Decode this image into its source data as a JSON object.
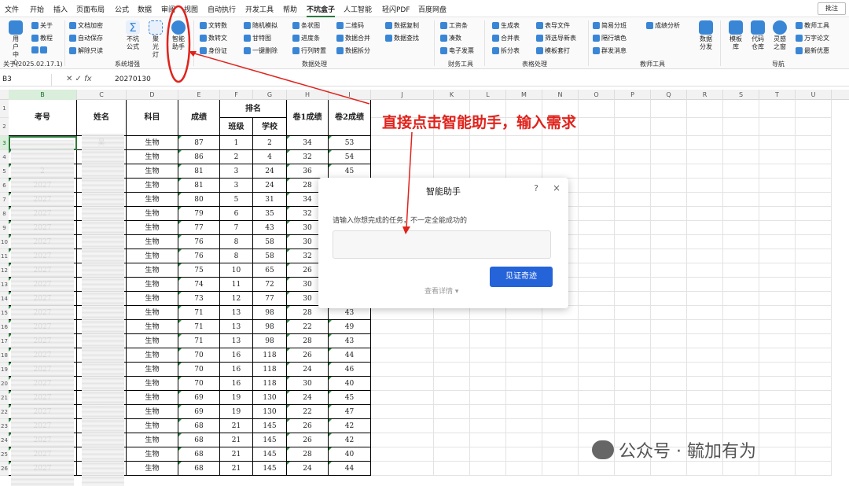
{
  "menu": [
    "文件",
    "开始",
    "插入",
    "页面布局",
    "公式",
    "数据",
    "审阅",
    "视图",
    "自动执行",
    "开发工具",
    "帮助",
    "不坑盒子",
    "人工智能",
    "轻闪PDF",
    "百度网盘"
  ],
  "comment_label": "批注",
  "ribbon": {
    "user_center": "用户中心",
    "about": "关于",
    "tutorial": "教程",
    "doc_encrypt": "文档加密",
    "auto_save": "自动保存",
    "unlock_readonly": "解除只读",
    "no_pit_formula": "不坑公式",
    "spotlight": "聚光灯",
    "smart_assistant": "智能助手",
    "text_to_num": "文转数",
    "num_to_text": "数转文",
    "id_card": "身份证",
    "random_sim": "随机模拟",
    "gantt": "甘特图",
    "one_click_delete": "一键删除",
    "bar_chart": "条状图",
    "progress_bar": "进度条",
    "row_col_convert": "行列转置",
    "qr_code": "二维码",
    "data_merge": "数据合并",
    "data_split": "数据拆分",
    "data_copy": "数据复制",
    "data_lookup": "数据查找",
    "pay_slip": "工资条",
    "round_up": "凑数",
    "e_invoice": "电子发票",
    "gen_table": "生成表",
    "merge_table": "合并表",
    "split_table": "拆分表",
    "header_import": "表导文件",
    "filter_new_table": "筛选导新表",
    "template_fill": "模板套打",
    "easy_class": "简易分班",
    "alt_row_color": "隔行填色",
    "group_msg": "群发消息",
    "score_analysis": "成绩分析",
    "data_split_big": "数据分发",
    "template_lib": "模板库",
    "code_repo": "代码仓库",
    "inspiration": "灵感之窗",
    "teacher_tools": "教师工具",
    "thesis": "万字论文",
    "latest_offers": "最新优惠"
  },
  "group_labels": {
    "about_version": "关于(2025.02.17.1)",
    "system_enhance": "系统增强",
    "data_processing": "数据处理",
    "finance_tools": "财务工具",
    "table_processing": "表格处理",
    "teacher_tools": "教师工具",
    "navigation": "导航"
  },
  "formula_bar": {
    "cell_ref": "B3",
    "fx": "fx",
    "value": "20270130"
  },
  "columns": [
    "B",
    "C",
    "D",
    "E",
    "F",
    "G",
    "H",
    "I",
    "J",
    "K",
    "L",
    "M",
    "N",
    "O",
    "P",
    "Q",
    "R",
    "S",
    "T",
    "U"
  ],
  "rows": [
    "1",
    "2",
    "3",
    "4",
    "5",
    "6",
    "7",
    "8",
    "9",
    "10",
    "11",
    "12",
    "13",
    "14",
    "15",
    "16",
    "17",
    "18",
    "19",
    "20",
    "21",
    "22",
    "23",
    "24",
    "25",
    "26",
    "27"
  ],
  "table": {
    "headers": {
      "id": "考号",
      "name": "姓名",
      "subject": "科目",
      "score": "成绩",
      "rank": "排名",
      "rank_class": "班级",
      "rank_school": "学校",
      "paper1": "卷1成绩",
      "paper2": "卷2成绩"
    },
    "rows": [
      {
        "id": "",
        "name": "吴",
        "subject": "生物",
        "score": "87",
        "cls": "1",
        "sch": "2",
        "p1": "34",
        "p2": "53"
      },
      {
        "id": "",
        "name": "",
        "subject": "生物",
        "score": "86",
        "cls": "2",
        "sch": "4",
        "p1": "32",
        "p2": "54"
      },
      {
        "id": "2",
        "name": "",
        "subject": "生物",
        "score": "81",
        "cls": "3",
        "sch": "24",
        "p1": "36",
        "p2": "45"
      },
      {
        "id": "2027",
        "name": "",
        "subject": "生物",
        "score": "81",
        "cls": "3",
        "sch": "24",
        "p1": "28",
        "p2": ""
      },
      {
        "id": "2027",
        "name": "",
        "subject": "生物",
        "score": "80",
        "cls": "5",
        "sch": "31",
        "p1": "34",
        "p2": ""
      },
      {
        "id": "2027",
        "name": "",
        "subject": "生物",
        "score": "79",
        "cls": "6",
        "sch": "35",
        "p1": "32",
        "p2": ""
      },
      {
        "id": "2027",
        "name": "",
        "subject": "生物",
        "score": "77",
        "cls": "7",
        "sch": "43",
        "p1": "30",
        "p2": ""
      },
      {
        "id": "2027",
        "name": "",
        "subject": "生物",
        "score": "76",
        "cls": "8",
        "sch": "58",
        "p1": "30",
        "p2": ""
      },
      {
        "id": "2027",
        "name": "",
        "subject": "生物",
        "score": "76",
        "cls": "8",
        "sch": "58",
        "p1": "32",
        "p2": ""
      },
      {
        "id": "2027",
        "name": "",
        "subject": "生物",
        "score": "75",
        "cls": "10",
        "sch": "65",
        "p1": "26",
        "p2": ""
      },
      {
        "id": "2027",
        "name": "",
        "subject": "生物",
        "score": "74",
        "cls": "11",
        "sch": "72",
        "p1": "30",
        "p2": ""
      },
      {
        "id": "2027",
        "name": "",
        "subject": "生物",
        "score": "73",
        "cls": "12",
        "sch": "77",
        "p1": "30",
        "p2": ""
      },
      {
        "id": "2027",
        "name": "",
        "subject": "生物",
        "score": "71",
        "cls": "13",
        "sch": "98",
        "p1": "28",
        "p2": "43"
      },
      {
        "id": "2027",
        "name": "",
        "subject": "生物",
        "score": "71",
        "cls": "13",
        "sch": "98",
        "p1": "22",
        "p2": "49"
      },
      {
        "id": "2027",
        "name": "",
        "subject": "生物",
        "score": "71",
        "cls": "13",
        "sch": "98",
        "p1": "28",
        "p2": "43"
      },
      {
        "id": "2027",
        "name": "",
        "subject": "生物",
        "score": "70",
        "cls": "16",
        "sch": "118",
        "p1": "26",
        "p2": "44"
      },
      {
        "id": "2027",
        "name": "",
        "subject": "生物",
        "score": "70",
        "cls": "16",
        "sch": "118",
        "p1": "24",
        "p2": "46"
      },
      {
        "id": "2027",
        "name": "",
        "subject": "生物",
        "score": "70",
        "cls": "16",
        "sch": "118",
        "p1": "30",
        "p2": "40"
      },
      {
        "id": "2027",
        "name": "",
        "subject": "生物",
        "score": "69",
        "cls": "19",
        "sch": "130",
        "p1": "24",
        "p2": "45"
      },
      {
        "id": "2027",
        "name": "",
        "subject": "生物",
        "score": "69",
        "cls": "19",
        "sch": "130",
        "p1": "22",
        "p2": "47"
      },
      {
        "id": "2027",
        "name": "",
        "subject": "生物",
        "score": "68",
        "cls": "21",
        "sch": "145",
        "p1": "26",
        "p2": "42"
      },
      {
        "id": "2027",
        "name": "",
        "subject": "生物",
        "score": "68",
        "cls": "21",
        "sch": "145",
        "p1": "26",
        "p2": "42"
      },
      {
        "id": "2027",
        "name": "",
        "subject": "生物",
        "score": "68",
        "cls": "21",
        "sch": "145",
        "p1": "28",
        "p2": "40"
      },
      {
        "id": "2027",
        "name": "",
        "subject": "生物",
        "score": "68",
        "cls": "21",
        "sch": "145",
        "p1": "24",
        "p2": "44"
      },
      {
        "id": "2027",
        "name": "",
        "subject": "生物",
        "score": "68",
        "cls": "21",
        "sch": "145",
        "p1": "24",
        "p2": "44"
      }
    ]
  },
  "dialog": {
    "title": "智能助手",
    "help": "?",
    "close": "×",
    "prompt_label": "请输入你想完成的任务，不一定全能成功的",
    "submit": "见证奇迹",
    "details": "查看详情"
  },
  "annotation": "直接点击智能助手，输入需求",
  "watermark": "公众号 · 毓加有为",
  "colors": {
    "accent_green": "#2a7a3b",
    "button_blue": "#2563d9",
    "annotation_red": "#e0231c"
  }
}
